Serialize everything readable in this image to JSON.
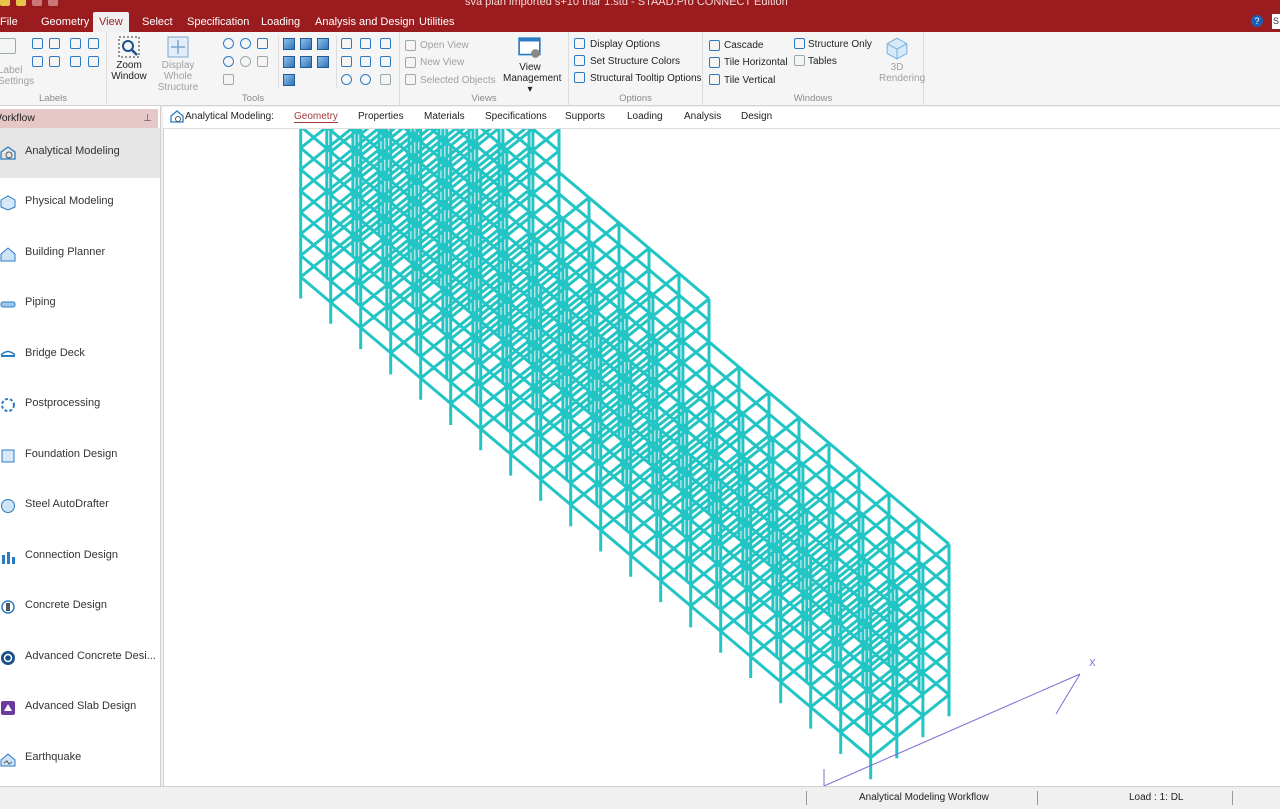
{
  "window": {
    "title": "sva plan imported s+10 thar 1.std - STAAD.Pro CONNECT Edition"
  },
  "menu": {
    "tabs": [
      "File",
      "Geometry",
      "View",
      "Select",
      "Specification",
      "Loading",
      "Analysis and Design",
      "Utilities"
    ],
    "active": "View",
    "help": "?",
    "search_stub": "S"
  },
  "ribbon": {
    "labels_group": {
      "title": "Labels",
      "label_settings": "Label Settings"
    },
    "tools_group": {
      "title": "Tools",
      "zoom_window": "Zoom Window",
      "display_whole": "Display Whole Structure"
    },
    "views_group": {
      "title": "Views",
      "open_view": "Open View",
      "new_view": "New View",
      "selected_objects": "Selected Objects",
      "view_management": "View Management ▾"
    },
    "options_group": {
      "title": "Options",
      "display_options": "Display Options",
      "set_structure_colors": "Set Structure Colors",
      "tooltip_options": "Structural Tooltip Options"
    },
    "windows_group": {
      "title": "Windows",
      "cascade": "Cascade",
      "tile_horizontal": "Tile Horizontal",
      "tile_vertical": "Tile Vertical",
      "structure_only": "Structure Only",
      "tables": "Tables",
      "rendering": "3D Rendering"
    }
  },
  "workflow": {
    "header": "Workflow",
    "items": [
      {
        "label": "Analytical Modeling",
        "active": true
      },
      {
        "label": "Physical Modeling"
      },
      {
        "label": "Building Planner"
      },
      {
        "label": "Piping"
      },
      {
        "label": "Bridge Deck"
      },
      {
        "label": "Postprocessing"
      },
      {
        "label": "Foundation Design"
      },
      {
        "label": "Steel AutoDrafter"
      },
      {
        "label": "Connection Design"
      },
      {
        "label": "Concrete Design"
      },
      {
        "label": "Advanced Concrete Desi..."
      },
      {
        "label": "Advanced Slab Design"
      },
      {
        "label": "Earthquake"
      }
    ]
  },
  "subtabs": {
    "prefix": "Analytical Modeling:",
    "items": [
      "Geometry",
      "Properties",
      "Materials",
      "Specifications",
      "Supports",
      "Loading",
      "Analysis",
      "Design"
    ],
    "active": "Geometry"
  },
  "viewport": {
    "axis_label": "X",
    "model_color": "#22c4c4"
  },
  "status": {
    "workflow": "Analytical Modeling Workflow",
    "load": "Load : 1: DL"
  }
}
